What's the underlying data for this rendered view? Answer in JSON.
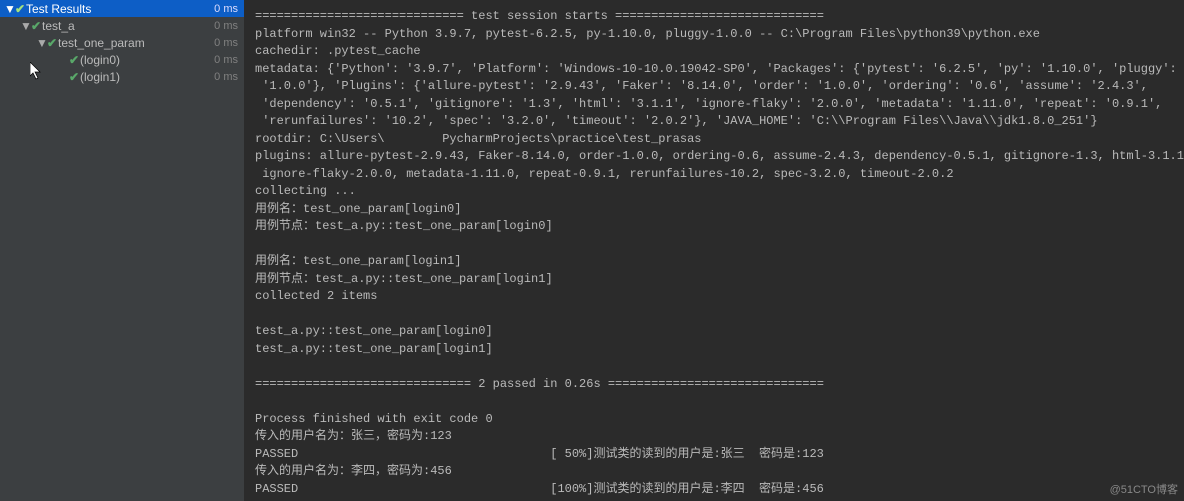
{
  "tree": {
    "root": {
      "label": "Test Results",
      "time": "0 ms"
    },
    "items": [
      {
        "label": "test_a",
        "time": "0 ms",
        "arrow": "▼",
        "indent": "indent1"
      },
      {
        "label": "test_one_param",
        "time": "0 ms",
        "arrow": "▼",
        "indent": "indent2"
      },
      {
        "label": "(login0)",
        "time": "0 ms",
        "arrow": "",
        "indent": "indent3"
      },
      {
        "label": "(login1)",
        "time": "0 ms",
        "arrow": "",
        "indent": "indent3"
      }
    ]
  },
  "console": {
    "text": "============================= test session starts =============================\nplatform win32 -- Python 3.9.7, pytest-6.2.5, py-1.10.0, pluggy-1.0.0 -- C:\\Program Files\\python39\\python.exe\ncachedir: .pytest_cache\nmetadata: {'Python': '3.9.7', 'Platform': 'Windows-10-10.0.19042-SP0', 'Packages': {'pytest': '6.2.5', 'py': '1.10.0', 'pluggy':\n '1.0.0'}, 'Plugins': {'allure-pytest': '2.9.43', 'Faker': '8.14.0', 'order': '1.0.0', 'ordering': '0.6', 'assume': '2.4.3',\n 'dependency': '0.5.1', 'gitignore': '1.3', 'html': '3.1.1', 'ignore-flaky': '2.0.0', 'metadata': '1.11.0', 'repeat': '0.9.1',\n 'rerunfailures': '10.2', 'spec': '3.2.0', 'timeout': '2.0.2'}, 'JAVA_HOME': 'C:\\\\Program Files\\\\Java\\\\jdk1.8.0_251'}\nrootdir: C:\\Users\\        PycharmProjects\\practice\\test_prasas\nplugins: allure-pytest-2.9.43, Faker-8.14.0, order-1.0.0, ordering-0.6, assume-2.4.3, dependency-0.5.1, gitignore-1.3, html-3.1.1,\n ignore-flaky-2.0.0, metadata-1.11.0, repeat-0.9.1, rerunfailures-10.2, spec-3.2.0, timeout-2.0.2\ncollecting ...\n用例名：test_one_param[login0]\n用例节点：test_a.py::test_one_param[login0]\n\n用例名：test_one_param[login1]\n用例节点：test_a.py::test_one_param[login1]\ncollected 2 items\n\ntest_a.py::test_one_param[login0]\ntest_a.py::test_one_param[login1]\n\n============================== 2 passed in 0.26s ==============================\n\nProcess finished with exit code 0\n传入的用户名为：张三，密码为:123\nPASSED                                   [ 50%]测试类的读到的用户是:张三  密码是:123\n传入的用户名为：李四，密码为:456\nPASSED                                   [100%]测试类的读到的用户是:李四  密码是:456"
  },
  "footer": "@51CTO博客"
}
